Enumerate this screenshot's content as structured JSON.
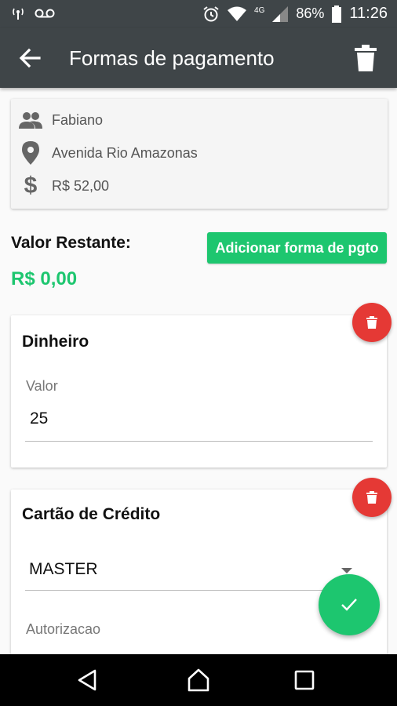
{
  "status_bar": {
    "battery": "86%",
    "time": "11:26",
    "network": "4G"
  },
  "app_bar": {
    "title": "Formas de pagamento"
  },
  "info": {
    "name": "Fabiano",
    "address": "Avenida Rio Amazonas",
    "total": "R$ 52,00"
  },
  "summary": {
    "remaining_label": "Valor Restante:",
    "remaining_value": "R$ 0,00",
    "add_button": "Adicionar forma de pgto"
  },
  "payments": [
    {
      "title": "Dinheiro",
      "field_label": "Valor",
      "field_value": "25"
    },
    {
      "title": "Cartão de Crédito",
      "select_value": "MASTER",
      "field_label": "Autorizacao"
    }
  ],
  "colors": {
    "accent": "#1dc66f",
    "danger": "#e53935",
    "toolbar": "#3f4548"
  }
}
